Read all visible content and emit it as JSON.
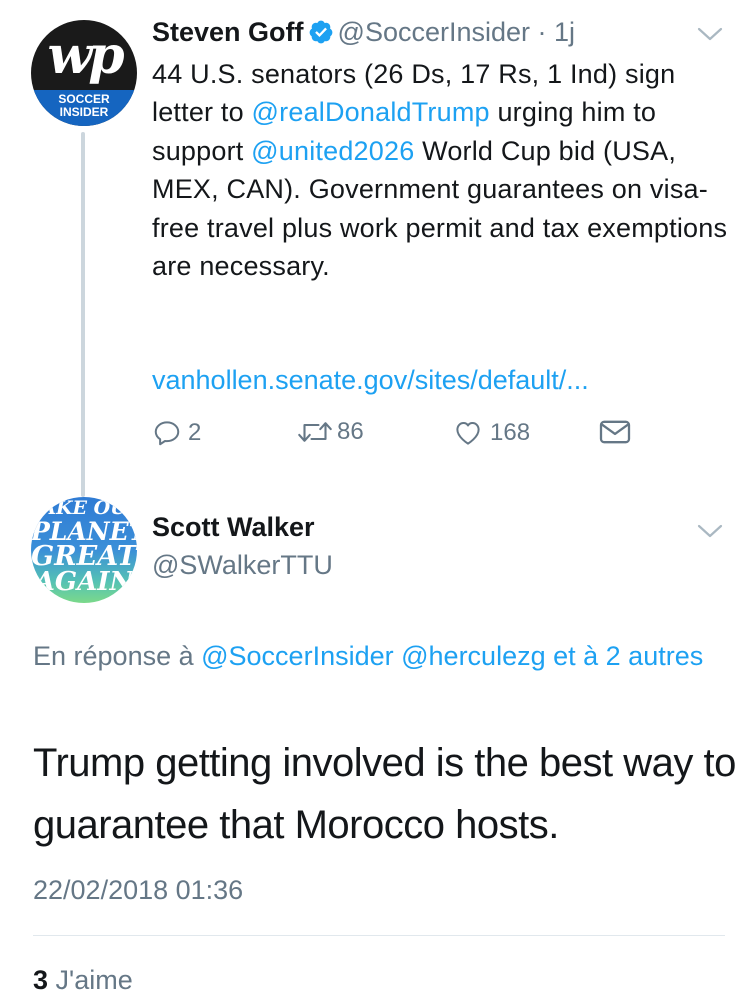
{
  "tweet1": {
    "avatar": {
      "monogram": "wp",
      "band_line1": "SOCCER",
      "band_line2": "INSIDER"
    },
    "author_name": "Steven Goff",
    "handle": "@SoccerInsider",
    "separator": " · ",
    "time": "1j",
    "text_parts": {
      "p1": "44 U.S. senators (26 Ds, 17 Rs, 1 Ind) sign letter to ",
      "mention1": "@realDonaldTrump",
      "p2": " urging him to support ",
      "mention2": "@united2026",
      "p3": " World Cup bid (USA, MEX, CAN). Government guarantees on visa-free travel plus work permit and tax exemptions are necessary."
    },
    "link": "vanhollen.senate.gov/sites/default/...",
    "actions": {
      "reply_count": "2",
      "retweet_count": "86",
      "like_count": "168"
    }
  },
  "tweet2": {
    "avatar": {
      "line1": "AKE OU",
      "line2": "PLANET",
      "line3": "GREAT",
      "line4": "AGAIN"
    },
    "author_name": "Scott Walker",
    "handle": "@SWalkerTTU",
    "reply_prefix": "En réponse à ",
    "reply_mention1": "@SoccerInsider",
    "reply_mention2": "@herculezg",
    "reply_suffix": "et à 2 autres",
    "text": "Trump getting involved is the best way to guarantee that Morocco hosts.",
    "timestamp": "22/02/2018 01:36",
    "likes_count": "3",
    "likes_label": "J'aime"
  },
  "colors": {
    "link": "#1da1f2",
    "secondary_text": "#657786",
    "primary_text": "#14171a",
    "verified_badge": "#1da1f2",
    "thread_line": "#ccd6dd"
  },
  "icons": [
    "verified-badge-icon",
    "chevron-down-icon",
    "reply-icon",
    "retweet-icon",
    "like-heart-icon",
    "direct-message-icon"
  ]
}
